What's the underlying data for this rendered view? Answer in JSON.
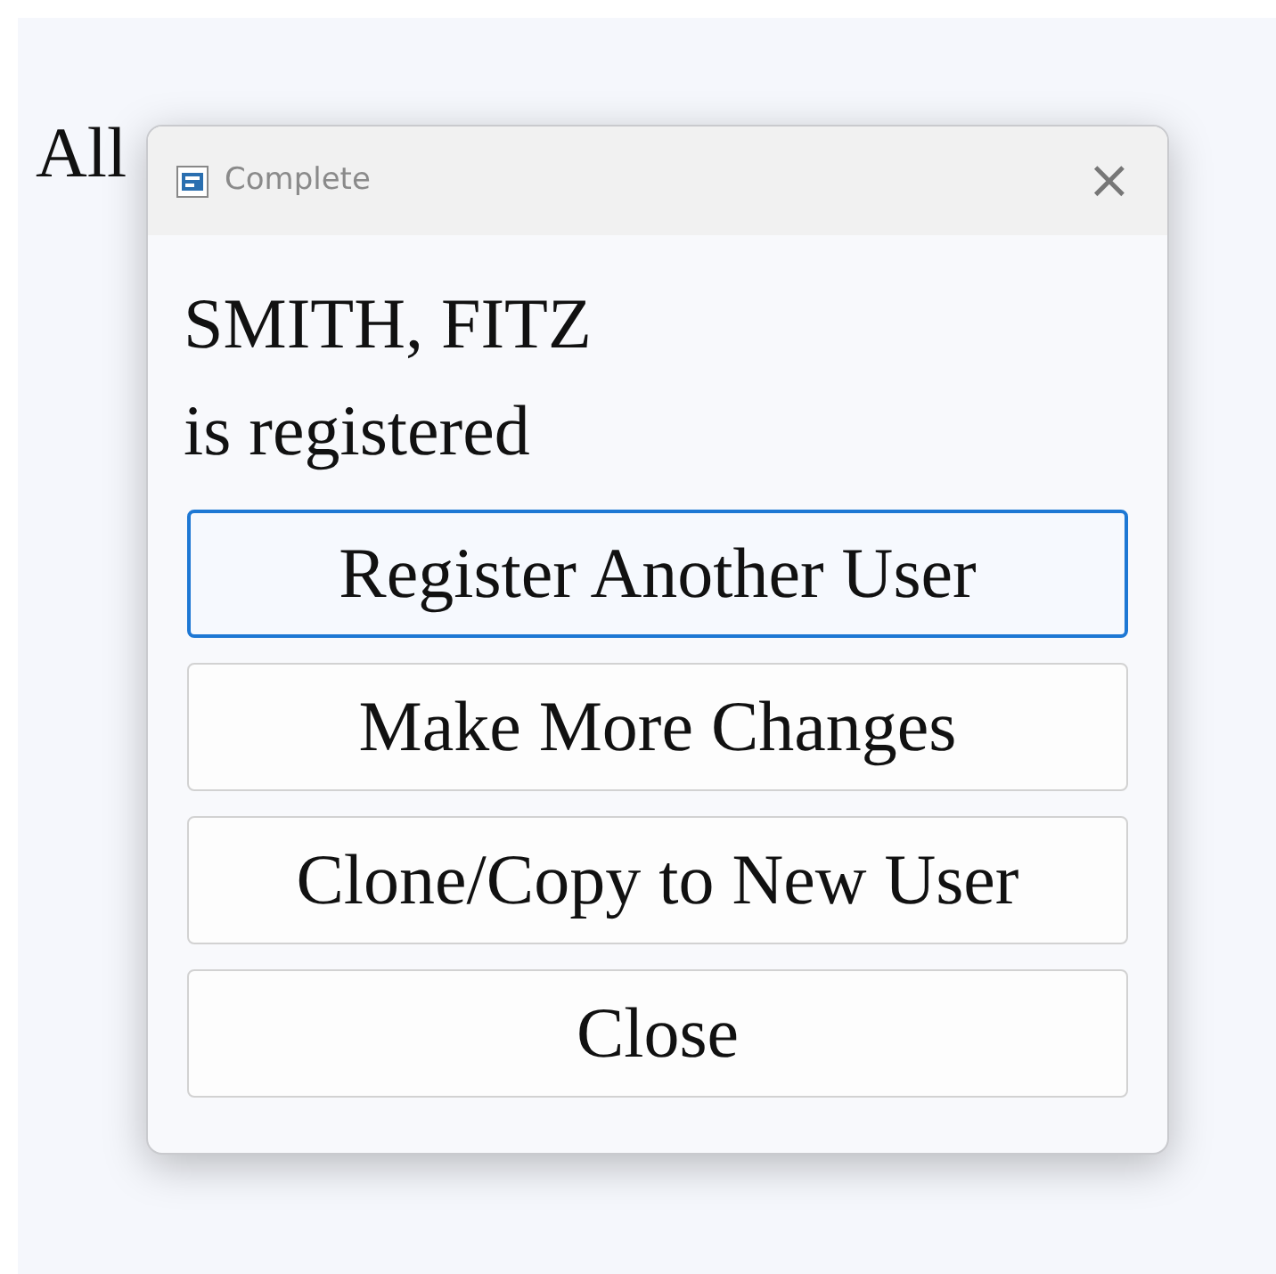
{
  "background": {
    "text": "All"
  },
  "dialog": {
    "title": "Complete",
    "close_glyph": "×",
    "message_name": "SMITH, FITZ",
    "message_status": "is registered",
    "buttons": [
      {
        "label": "Register Another User",
        "focused": true
      },
      {
        "label": "Make More Changes",
        "focused": false
      },
      {
        "label": "Clone/Copy to New User",
        "focused": false
      },
      {
        "label": "Close",
        "focused": false
      }
    ]
  }
}
